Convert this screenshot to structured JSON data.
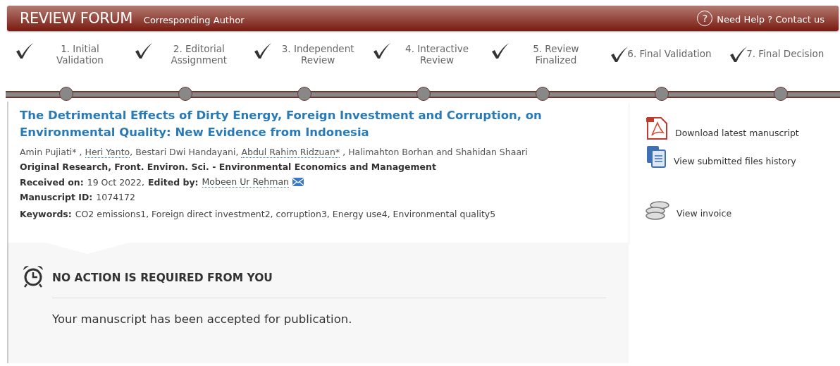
{
  "header": {
    "title": "REVIEW FORUM",
    "role": "Corresponding Author",
    "help_icon": "?",
    "help": "Need Help ? Contact us"
  },
  "steps": [
    {
      "lines": [
        "1. Initial",
        "Validation"
      ],
      "done": true
    },
    {
      "lines": [
        "2. Editorial",
        "Assignment"
      ],
      "done": true
    },
    {
      "lines": [
        "3. Independent",
        "Review"
      ],
      "done": true
    },
    {
      "lines": [
        "4. Interactive",
        "Review"
      ],
      "done": true
    },
    {
      "lines": [
        "5. Review",
        "Finalized"
      ],
      "done": true
    },
    {
      "lines": [
        "6. Final Validation"
      ],
      "done": true
    },
    {
      "lines": [
        "7. Final Decision"
      ],
      "done": true
    }
  ],
  "article": {
    "title": "The Detrimental Effects of Dirty Energy, Foreign Investment and Corruption, on Environmental Quality: New Evidence from Indonesia",
    "authors": [
      {
        "name": "Amin Pujiati*",
        "linked": false,
        "sep": " , "
      },
      {
        "name": "Heri Yanto",
        "linked": true,
        "sep": ", "
      },
      {
        "name": "Bestari Dwi Handayani",
        "linked": false,
        "sep": ", "
      },
      {
        "name": "Abdul Rahim Ridzuan*",
        "linked": true,
        "sep": " , "
      },
      {
        "name": "Halimahton Borhan and Shahidan Shaari",
        "linked": false
      }
    ],
    "type": "Original Research, Front. Environ. Sci. - Environmental Economics and Management",
    "received_label": "Received on:",
    "received": "19 Oct 2022,",
    "edited_label": "Edited by:",
    "editor": "Mobeen Ur Rehman",
    "id_label": "Manuscript ID:",
    "id": "1074172",
    "keywords_label": "Keywords:",
    "keywords": "CO2 emissions1, Foreign direct investment2, corruption3, Energy use4, Environmental quality5"
  },
  "status": {
    "title": "NO ACTION IS REQUIRED FROM YOU",
    "message": "Your manuscript has been accepted for publication."
  },
  "sidebar": [
    {
      "kind": "pdf",
      "label": "Download latest manuscript"
    },
    {
      "kind": "files",
      "label": "View submitted files history"
    },
    {
      "kind": "coins",
      "label": "View invoice"
    }
  ]
}
